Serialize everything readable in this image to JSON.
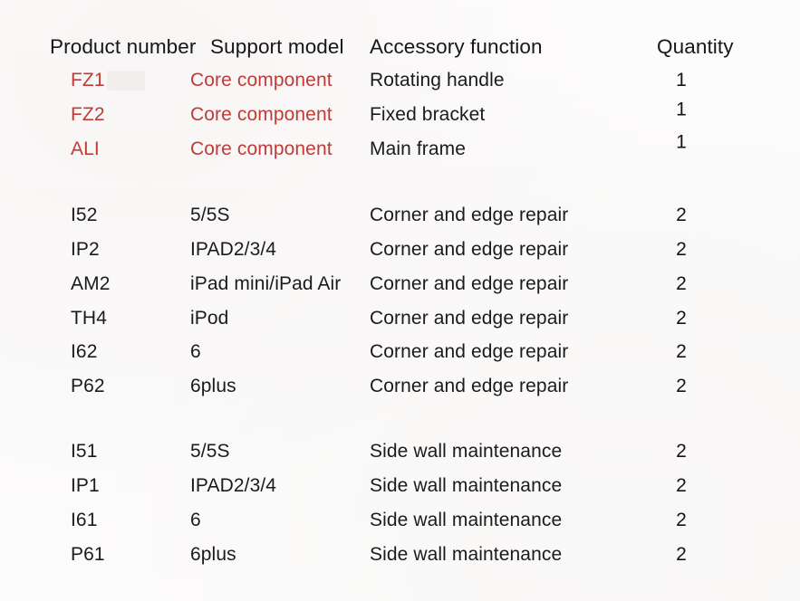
{
  "table": {
    "headers": {
      "product_number": "Product number",
      "support_model": "Support model",
      "accessory_function": "Accessory function",
      "quantity": "Quantity"
    },
    "groups": [
      {
        "name": "core-components",
        "rows": [
          {
            "product_number": "FZ1",
            "support_model": "Core component",
            "accessory_function": "Rotating handle",
            "quantity": "1"
          },
          {
            "product_number": "FZ2",
            "support_model": "Core component",
            "accessory_function": "Fixed bracket",
            "quantity": "1"
          },
          {
            "product_number": "ALI",
            "support_model": "Core component",
            "accessory_function": "Main frame",
            "quantity": "1"
          }
        ]
      },
      {
        "name": "corner-and-edge-repair",
        "rows": [
          {
            "product_number": "I52",
            "support_model": "5/5S",
            "accessory_function": "Corner and edge repair",
            "quantity": "2"
          },
          {
            "product_number": "IP2",
            "support_model": "IPAD2/3/4",
            "accessory_function": "Corner and edge repair",
            "quantity": "2"
          },
          {
            "product_number": "AM2",
            "support_model": "iPad mini/iPad Air",
            "accessory_function": "Corner and edge repair",
            "quantity": "2"
          },
          {
            "product_number": "TH4",
            "support_model": "iPod",
            "accessory_function": "Corner and edge repair",
            "quantity": "2"
          },
          {
            "product_number": "I62",
            "support_model": "6",
            "accessory_function": "Corner and edge repair",
            "quantity": "2"
          },
          {
            "product_number": "P62",
            "support_model": "6plus",
            "accessory_function": "Corner and edge repair",
            "quantity": "2"
          }
        ]
      },
      {
        "name": "side-wall-maintenance",
        "rows": [
          {
            "product_number": "I51",
            "support_model": "5/5S",
            "accessory_function": "Side wall maintenance",
            "quantity": "2"
          },
          {
            "product_number": "IP1",
            "support_model": "IPAD2/3/4",
            "accessory_function": "Side wall maintenance",
            "quantity": "2"
          },
          {
            "product_number": "I61",
            "support_model": "6",
            "accessory_function": "Side wall maintenance",
            "quantity": "2"
          },
          {
            "product_number": "P61",
            "support_model": "6plus",
            "accessory_function": "Side wall maintenance",
            "quantity": "2"
          }
        ]
      }
    ]
  },
  "colors": {
    "core_component_red": "#bf3b38",
    "body_text": "#1b1b1b",
    "background": "#fcfbfb"
  }
}
